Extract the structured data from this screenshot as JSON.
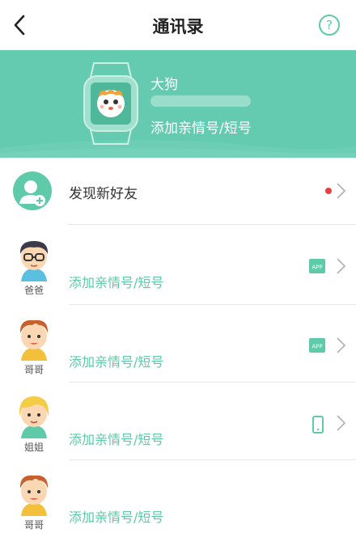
{
  "navbar": {
    "title": "通讯录",
    "help_glyph": "?"
  },
  "device": {
    "name": "大狗",
    "add_label": "添加亲情号/短号"
  },
  "discover": {
    "label": "发现新好友"
  },
  "contacts": [
    {
      "role": "爸爸",
      "add_label": "添加亲情号/短号",
      "badge": "APP"
    },
    {
      "role": "哥哥",
      "add_label": "添加亲情号/短号",
      "badge": "APP"
    },
    {
      "role": "姐姐",
      "add_label": "添加亲情号/短号",
      "badge": "phone"
    },
    {
      "role": "哥哥",
      "add_label": "添加亲情号/短号",
      "badge": ""
    }
  ],
  "colors": {
    "accent": "#5ecaa8",
    "header_bg": "#64cbb0",
    "notify_dot": "#e64040"
  }
}
